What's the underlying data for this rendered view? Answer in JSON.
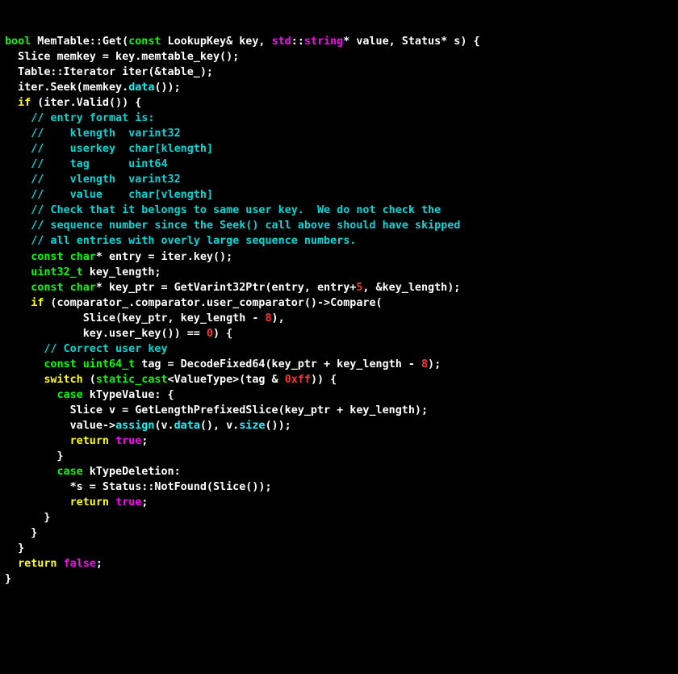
{
  "code": {
    "l1": {
      "a": "bool",
      "b": " MemTable::Get(",
      "c": "const",
      "d": " LookupKey& key, ",
      "e": "std",
      "f": "::",
      "g": "string",
      "h": "* value, Status* s) {"
    },
    "l2": "  Slice memkey = key.memtable_key();",
    "l3": "  Table::Iterator iter(&table_);",
    "l4": {
      "a": "  iter.Seek(memkey.",
      "b": "data",
      "c": "());"
    },
    "l5": {
      "a": "  ",
      "b": "if",
      "c": " (iter.Valid()) {"
    },
    "l6": "    // entry format is:",
    "l7": "    //    klength  varint32",
    "l8": "    //    userkey  char[klength]",
    "l9": "    //    tag      uint64",
    "l10": "    //    vlength  varint32",
    "l11": "    //    value    char[vlength]",
    "l12": "    // Check that it belongs to same user key.  We do not check the",
    "l13": "    // sequence number since the Seek() call above should have skipped",
    "l14": "    // all entries with overly large sequence numbers.",
    "l15": {
      "a": "    ",
      "b": "const",
      "c": " ",
      "d": "char",
      "e": "* entry = iter.key();"
    },
    "l16": {
      "a": "    ",
      "b": "uint32_t",
      "c": " key_length;"
    },
    "l17": {
      "a": "    ",
      "b": "const",
      "c": " ",
      "d": "char",
      "e": "* key_ptr = GetVarint32Ptr(entry, entry+",
      "f": "5",
      "g": ", &key_length);"
    },
    "l18": {
      "a": "    ",
      "b": "if",
      "c": " (comparator_.comparator.user_comparator()->Compare("
    },
    "l19": {
      "a": "            Slice(key_ptr, key_length - ",
      "b": "8",
      "c": "),"
    },
    "l20": {
      "a": "            key.user_key()) == ",
      "b": "0",
      "c": ") {"
    },
    "l21": "      // Correct user key",
    "l22": {
      "a": "      ",
      "b": "const",
      "c": " ",
      "d": "uint64_t",
      "e": " tag = DecodeFixed64(key_ptr + key_length - ",
      "f": "8",
      "g": ");"
    },
    "l23": {
      "a": "      ",
      "b": "switch",
      "c": " (",
      "d": "static_cast",
      "e": "<ValueType>(tag & ",
      "f": "0xff",
      "g": ")) {"
    },
    "l24": {
      "a": "        ",
      "b": "case",
      "c": " kTypeValue: {"
    },
    "l25": "          Slice v = GetLengthPrefixedSlice(key_ptr + key_length);",
    "l26": {
      "a": "          value->",
      "b": "assign",
      "c": "(v.",
      "d": "data",
      "e": "(), v.",
      "f": "size",
      "g": "());"
    },
    "l27": {
      "a": "          ",
      "b": "return",
      "c": " ",
      "d": "true",
      "e": ";"
    },
    "l28": "        }",
    "l29": {
      "a": "        ",
      "b": "case",
      "c": " kTypeDeletion:"
    },
    "l30": "          *s = Status::NotFound(Slice());",
    "l31": {
      "a": "          ",
      "b": "return",
      "c": " ",
      "d": "true",
      "e": ";"
    },
    "l32": "      }",
    "l33": "    }",
    "l34": "  }",
    "l35": {
      "a": "  ",
      "b": "return",
      "c": " ",
      "d": "false",
      "e": ";"
    },
    "l36": "}"
  }
}
